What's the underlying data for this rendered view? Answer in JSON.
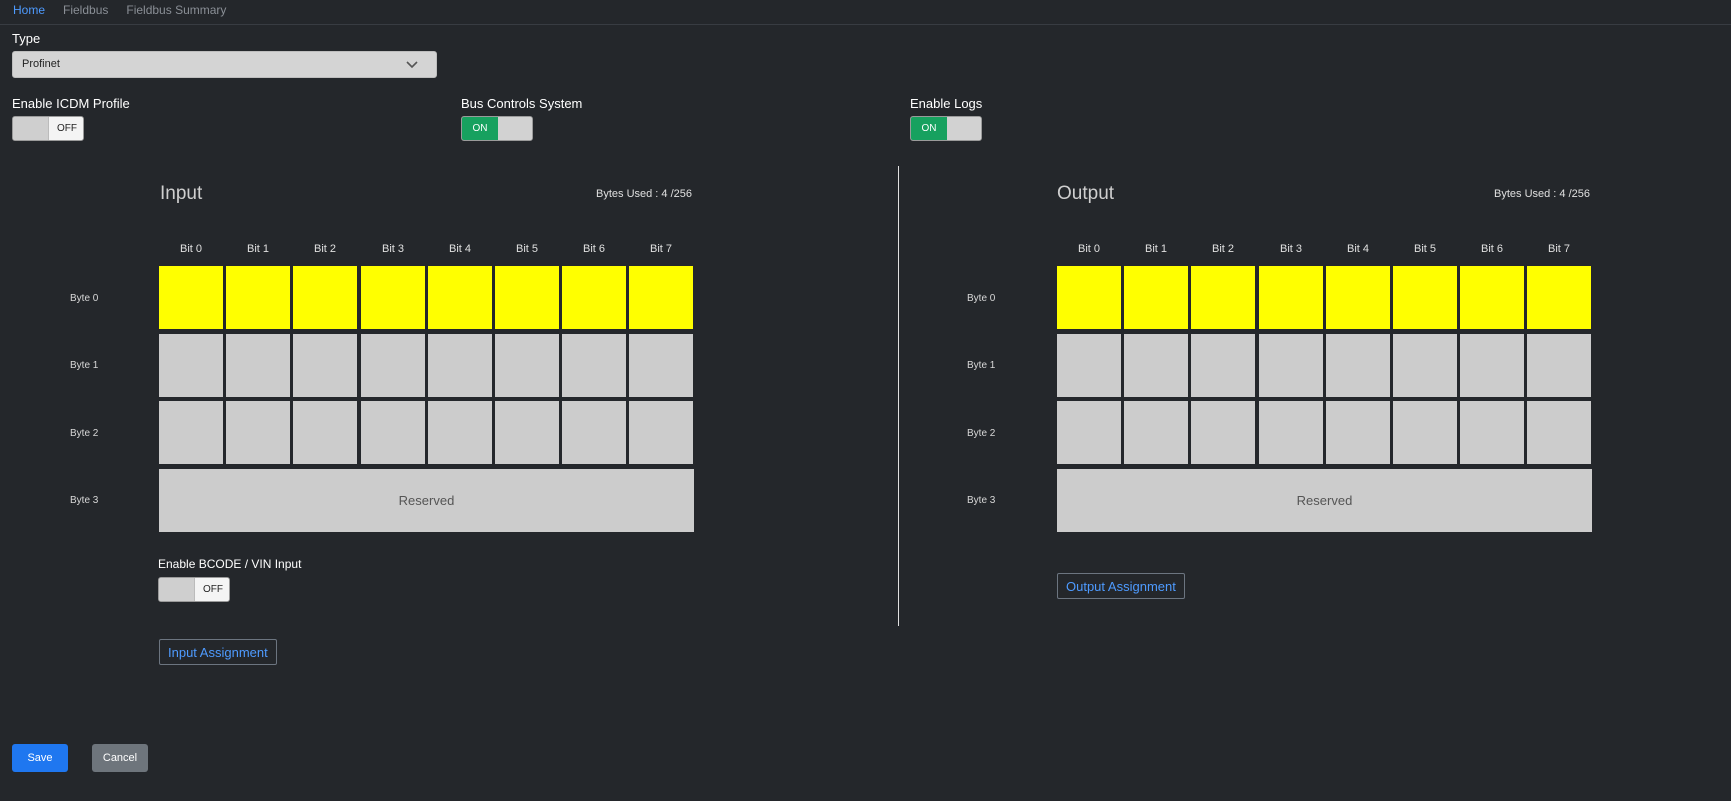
{
  "tabs": [
    "Home",
    "Fieldbus",
    "Fieldbus Summary"
  ],
  "type": {
    "label": "Type",
    "value": "Profinet"
  },
  "toggles": {
    "icdm": {
      "label": "Enable ICDM Profile",
      "state": "OFF"
    },
    "bus": {
      "label": "Bus Controls System",
      "state": "ON"
    },
    "logs": {
      "label": "Enable Logs",
      "state": "ON"
    },
    "bcode": {
      "label": "Enable BCODE / VIN Input",
      "state": "OFF"
    }
  },
  "input": {
    "title": "Input",
    "bytes_used": "Bytes Used : 4 /256",
    "bits": [
      "Bit 0",
      "Bit 1",
      "Bit 2",
      "Bit 3",
      "Bit 4",
      "Bit 5",
      "Bit 6",
      "Bit 7"
    ],
    "bytes": [
      "Byte 0",
      "Byte 1",
      "Byte 2",
      "Byte 3"
    ],
    "reserved": "Reserved",
    "assign_button": "Input Assignment"
  },
  "output": {
    "title": "Output",
    "bytes_used": "Bytes Used : 4 /256",
    "bits": [
      "Bit 0",
      "Bit 1",
      "Bit 2",
      "Bit 3",
      "Bit 4",
      "Bit 5",
      "Bit 6",
      "Bit 7"
    ],
    "bytes": [
      "Byte 0",
      "Byte 1",
      "Byte 2",
      "Byte 3"
    ],
    "reserved": "Reserved",
    "assign_button": "Output Assignment"
  },
  "buttons": {
    "save": "Save",
    "cancel": "Cancel"
  },
  "colors": {
    "used_bit": "#ffff00",
    "free_bit": "#cccccc",
    "on": "#17a15f",
    "accent": "#4e9bff"
  }
}
